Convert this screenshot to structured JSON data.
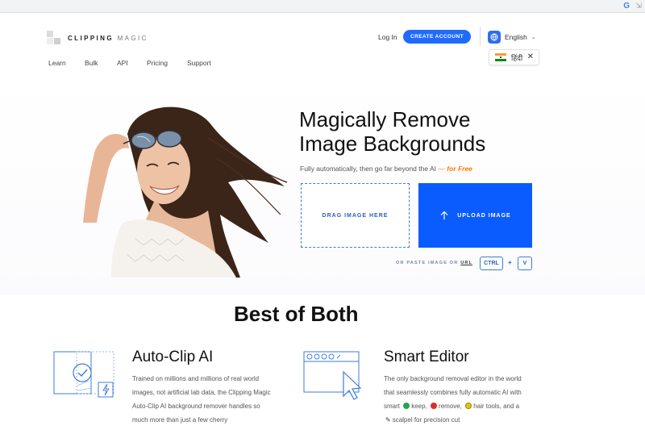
{
  "browser": {
    "g_icon": "G",
    "ext_icon": "⇲"
  },
  "header": {
    "logo": {
      "word1": "CLIPPING",
      "word2": "MAGIC"
    },
    "nav": [
      "Learn",
      "Bulk",
      "API",
      "Pricing",
      "Support"
    ],
    "login": "Log In",
    "create_account": "CREATE ACCOUNT",
    "language": "English",
    "language_suggestion": "हिंदी"
  },
  "hero": {
    "headline_line1": "Magically Remove",
    "headline_line2": "Image Backgrounds",
    "subline_text": "Fully automatically, then go far beyond the AI",
    "subline_dash": "—",
    "subline_free": "for Free",
    "drop_label": "DRAG IMAGE HERE",
    "upload_label": "UPLOAD IMAGE",
    "paste_prefix": "OR PASTE IMAGE OR",
    "paste_url": "URL",
    "key_ctrl": "CTRL",
    "key_plus": "+",
    "key_v": "V"
  },
  "section": {
    "title": "Best of Both",
    "features": [
      {
        "title": "Auto-Clip AI",
        "body": "Trained on millions and millions of real world images, not artificial lab data, the Clipping Magic Auto-Clip AI background remover handles so much more than just a few cherry"
      },
      {
        "title": "Smart Editor",
        "body_1": "The only background removal editor in the world that seamlessly combines fully automatic AI with smart",
        "keep": "keep,",
        "remove": "remove,",
        "hair": "hair tools, and a",
        "scalpel": "scalpel for precision cut"
      }
    ]
  },
  "colors": {
    "accent": "#1f6bff",
    "upload": "#0a5cff",
    "free": "#ff7a00"
  }
}
